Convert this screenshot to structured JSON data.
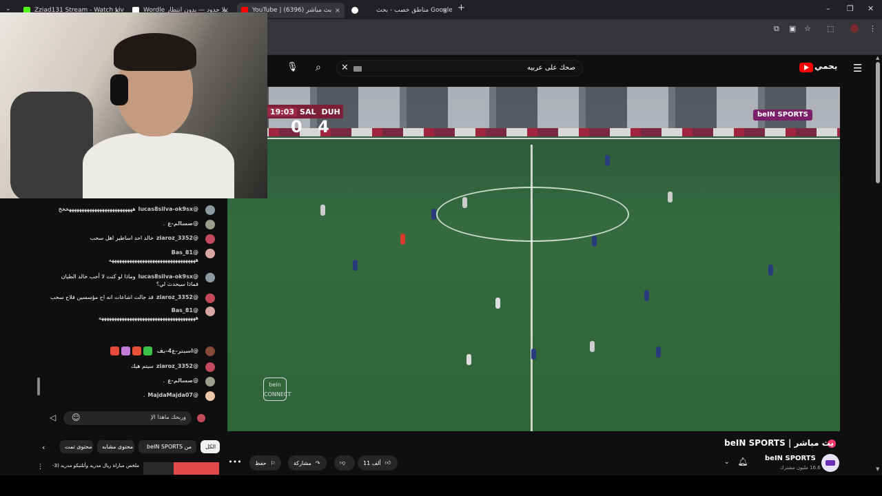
{
  "browser": {
    "tabs": [
      {
        "title": "Zziad131 Stream - Watch Live o",
        "color": "#53fc18"
      },
      {
        "title": "Wordle بلا حدود — بدون انتظار",
        "color": "#ffffff"
      },
      {
        "title": "YouTube | بث مباشر (6396)",
        "color": "#ff0000"
      },
      {
        "title": "مناطق خصب - بحث Google",
        "color": "#ffffff"
      }
    ],
    "new_tab": "+",
    "close_glyph": "×",
    "window_controls": [
      "–",
      "❐",
      "✕"
    ]
  },
  "youtube": {
    "search_value": "صحك على عربيه",
    "logo_text": "يحمي"
  },
  "video": {
    "scoreboard": {
      "time": "19:03",
      "home": "SAL",
      "away": "DUH",
      "home_score": "0",
      "away_score": "4"
    },
    "broadcaster_badge": "beIN SPORTS",
    "connect_badge": "bein CONNECT",
    "title": "بث مباشر | beIN SPORTS",
    "channel_name": "beIN SPORTS",
    "subscribers": "16.6 مليون مشترك",
    "likes": "11 ألف",
    "share_label": "مشاركة",
    "save_label": "حفظ",
    "more_label": "•••"
  },
  "chat": {
    "messages": [
      {
        "name": "@lucas8silva-ok9sx",
        "text": "ههههههههههههههههههههههههههخخخ",
        "avatar": "#8a9aa0"
      },
      {
        "name": "@صسالم-ع",
        "text": ".",
        "avatar": "#9aa08a"
      },
      {
        "name": "@ziaroz_3352",
        "text": "خالد احد اساطير اهل سحب",
        "avatar": "#c24a5a"
      },
      {
        "name": "@Bas_81",
        "text": "ههههههههههههههههههههههههههههههههههه",
        "avatar": "#d8a8a0"
      },
      {
        "name": "@lucas8silva-ok9sx",
        "text": "وماذا لو كنت لا أحب خالد الطيان فماذا سيحدث لي؟",
        "avatar": "#8a9aa0"
      },
      {
        "name": "@ziaroz_3352",
        "text": "قد جالت اشاعات انه اح مؤسسين فلاح سحب",
        "avatar": "#c24a5a"
      },
      {
        "name": "@Bas_81",
        "text": "ههههههههههههههههههههههههههههههههههههههه",
        "avatar": "#d8a8a0"
      },
      {
        "name": "@اسيتر-ع4-يف",
        "text": "",
        "avatar": "#8a4a3a",
        "emojis": [
          "#e84a3a",
          "#c27bd8",
          "#e8503a",
          "#3ac24a"
        ]
      },
      {
        "name": "@ziaroz_3352",
        "text": "سيتم هيك",
        "avatar": "#c24a5a"
      },
      {
        "name": "@صسالم-ع",
        "text": ".",
        "avatar": "#9aa08a"
      },
      {
        "name": "@MajdaMajda07",
        "text": ".",
        "avatar": "#f0c8a8"
      }
    ],
    "input_value": "وربحك ماهذا الإ",
    "send_icon": "send-icon",
    "emoji_icon": "emoji-icon"
  },
  "chips": [
    {
      "label": "الكل",
      "active": true
    },
    {
      "label": "من beIN SPORTS",
      "active": false
    },
    {
      "label": "محتوى مشابه",
      "active": false
    },
    {
      "label": "محتوى تمت",
      "active": false
    }
  ],
  "related": {
    "title": "ملخص مباراة ريال مدريد وأتلتيكو مدريد (3-"
  }
}
